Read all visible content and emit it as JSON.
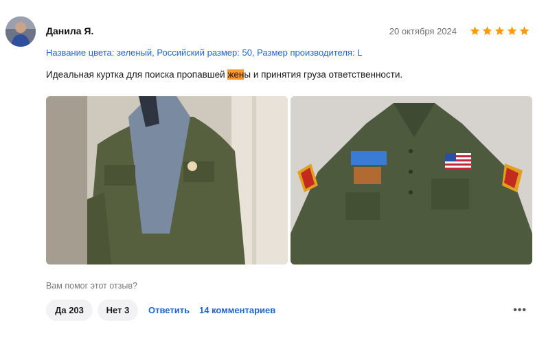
{
  "review": {
    "author": "Данила Я.",
    "date": "20 октября 2024",
    "rating": 5,
    "rating_max": 5,
    "star_color": "#ff9a00",
    "variant_info": "Название цвета: зеленый, Российский размер: 50, Размер производителя: L",
    "text_before": "Идеальная куртка для поиска пропавшей ",
    "text_highlight": "жен",
    "text_after": "ы и принятия груза ответственности."
  },
  "photos": [
    {
      "alt_icon": "photo-jacket-worn"
    },
    {
      "alt_icon": "photo-jacket-flat"
    }
  ],
  "feedback": {
    "question": "Вам помог этот отзыв?",
    "yes_label": "Да 203",
    "no_label": "Нет 3",
    "reply_label": "Ответить",
    "comments_label": "14 комментариев",
    "more_label": "•••"
  },
  "colors": {
    "link": "#1f64d6",
    "highlight": "#ff9a2a",
    "pill_bg": "#f2f2f5"
  }
}
